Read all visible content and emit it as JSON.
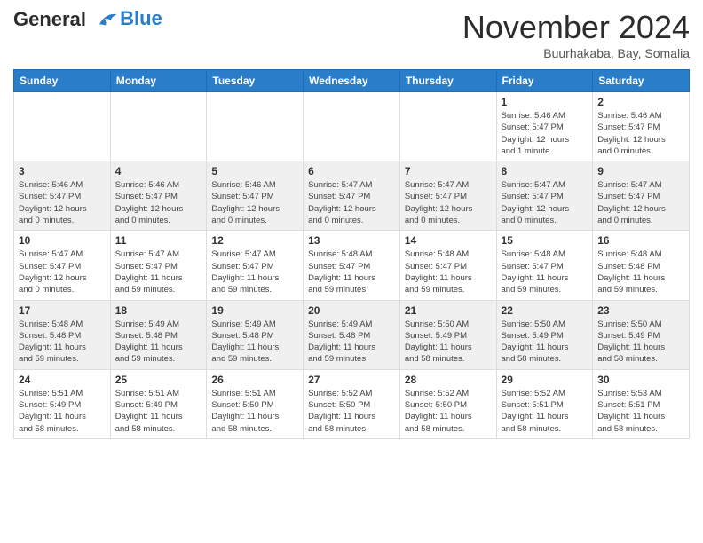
{
  "header": {
    "logo_line1": "General",
    "logo_line2": "Blue",
    "month": "November 2024",
    "location": "Buurhakaba, Bay, Somalia"
  },
  "weekdays": [
    "Sunday",
    "Monday",
    "Tuesday",
    "Wednesday",
    "Thursday",
    "Friday",
    "Saturday"
  ],
  "weeks": [
    [
      {
        "day": "",
        "info": ""
      },
      {
        "day": "",
        "info": ""
      },
      {
        "day": "",
        "info": ""
      },
      {
        "day": "",
        "info": ""
      },
      {
        "day": "",
        "info": ""
      },
      {
        "day": "1",
        "info": "Sunrise: 5:46 AM\nSunset: 5:47 PM\nDaylight: 12 hours\nand 1 minute."
      },
      {
        "day": "2",
        "info": "Sunrise: 5:46 AM\nSunset: 5:47 PM\nDaylight: 12 hours\nand 0 minutes."
      }
    ],
    [
      {
        "day": "3",
        "info": "Sunrise: 5:46 AM\nSunset: 5:47 PM\nDaylight: 12 hours\nand 0 minutes."
      },
      {
        "day": "4",
        "info": "Sunrise: 5:46 AM\nSunset: 5:47 PM\nDaylight: 12 hours\nand 0 minutes."
      },
      {
        "day": "5",
        "info": "Sunrise: 5:46 AM\nSunset: 5:47 PM\nDaylight: 12 hours\nand 0 minutes."
      },
      {
        "day": "6",
        "info": "Sunrise: 5:47 AM\nSunset: 5:47 PM\nDaylight: 12 hours\nand 0 minutes."
      },
      {
        "day": "7",
        "info": "Sunrise: 5:47 AM\nSunset: 5:47 PM\nDaylight: 12 hours\nand 0 minutes."
      },
      {
        "day": "8",
        "info": "Sunrise: 5:47 AM\nSunset: 5:47 PM\nDaylight: 12 hours\nand 0 minutes."
      },
      {
        "day": "9",
        "info": "Sunrise: 5:47 AM\nSunset: 5:47 PM\nDaylight: 12 hours\nand 0 minutes."
      }
    ],
    [
      {
        "day": "10",
        "info": "Sunrise: 5:47 AM\nSunset: 5:47 PM\nDaylight: 12 hours\nand 0 minutes."
      },
      {
        "day": "11",
        "info": "Sunrise: 5:47 AM\nSunset: 5:47 PM\nDaylight: 11 hours\nand 59 minutes."
      },
      {
        "day": "12",
        "info": "Sunrise: 5:47 AM\nSunset: 5:47 PM\nDaylight: 11 hours\nand 59 minutes."
      },
      {
        "day": "13",
        "info": "Sunrise: 5:48 AM\nSunset: 5:47 PM\nDaylight: 11 hours\nand 59 minutes."
      },
      {
        "day": "14",
        "info": "Sunrise: 5:48 AM\nSunset: 5:47 PM\nDaylight: 11 hours\nand 59 minutes."
      },
      {
        "day": "15",
        "info": "Sunrise: 5:48 AM\nSunset: 5:47 PM\nDaylight: 11 hours\nand 59 minutes."
      },
      {
        "day": "16",
        "info": "Sunrise: 5:48 AM\nSunset: 5:48 PM\nDaylight: 11 hours\nand 59 minutes."
      }
    ],
    [
      {
        "day": "17",
        "info": "Sunrise: 5:48 AM\nSunset: 5:48 PM\nDaylight: 11 hours\nand 59 minutes."
      },
      {
        "day": "18",
        "info": "Sunrise: 5:49 AM\nSunset: 5:48 PM\nDaylight: 11 hours\nand 59 minutes."
      },
      {
        "day": "19",
        "info": "Sunrise: 5:49 AM\nSunset: 5:48 PM\nDaylight: 11 hours\nand 59 minutes."
      },
      {
        "day": "20",
        "info": "Sunrise: 5:49 AM\nSunset: 5:48 PM\nDaylight: 11 hours\nand 59 minutes."
      },
      {
        "day": "21",
        "info": "Sunrise: 5:50 AM\nSunset: 5:49 PM\nDaylight: 11 hours\nand 58 minutes."
      },
      {
        "day": "22",
        "info": "Sunrise: 5:50 AM\nSunset: 5:49 PM\nDaylight: 11 hours\nand 58 minutes."
      },
      {
        "day": "23",
        "info": "Sunrise: 5:50 AM\nSunset: 5:49 PM\nDaylight: 11 hours\nand 58 minutes."
      }
    ],
    [
      {
        "day": "24",
        "info": "Sunrise: 5:51 AM\nSunset: 5:49 PM\nDaylight: 11 hours\nand 58 minutes."
      },
      {
        "day": "25",
        "info": "Sunrise: 5:51 AM\nSunset: 5:49 PM\nDaylight: 11 hours\nand 58 minutes."
      },
      {
        "day": "26",
        "info": "Sunrise: 5:51 AM\nSunset: 5:50 PM\nDaylight: 11 hours\nand 58 minutes."
      },
      {
        "day": "27",
        "info": "Sunrise: 5:52 AM\nSunset: 5:50 PM\nDaylight: 11 hours\nand 58 minutes."
      },
      {
        "day": "28",
        "info": "Sunrise: 5:52 AM\nSunset: 5:50 PM\nDaylight: 11 hours\nand 58 minutes."
      },
      {
        "day": "29",
        "info": "Sunrise: 5:52 AM\nSunset: 5:51 PM\nDaylight: 11 hours\nand 58 minutes."
      },
      {
        "day": "30",
        "info": "Sunrise: 5:53 AM\nSunset: 5:51 PM\nDaylight: 11 hours\nand 58 minutes."
      }
    ]
  ]
}
